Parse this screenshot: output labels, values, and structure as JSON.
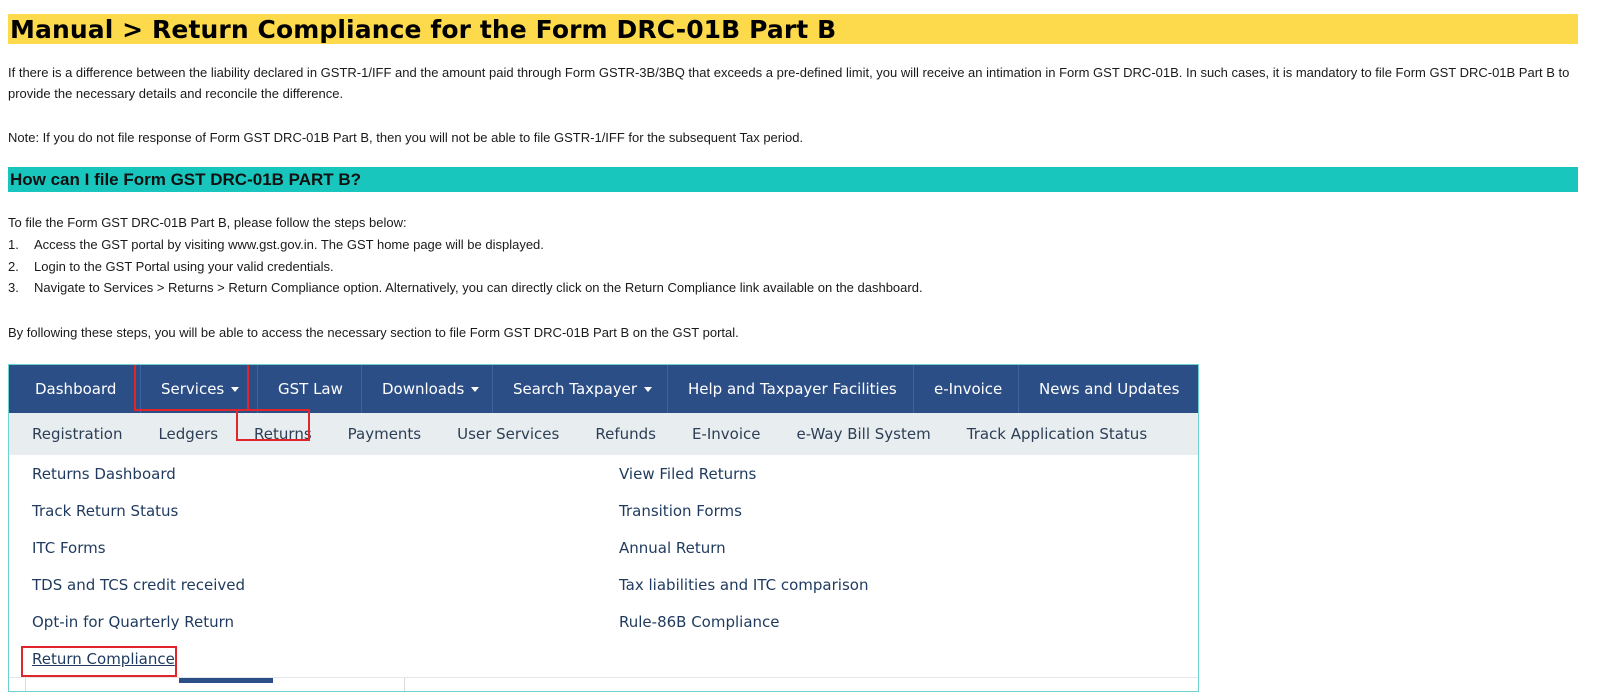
{
  "page": {
    "title": "Manual > Return Compliance for the Form DRC-01B Part B",
    "intro": "If there is a difference between the liability declared in GSTR-1/IFF and the amount paid through Form GSTR-3B/3BQ that exceeds a pre-defined limit, you will receive an intimation in Form GST DRC-01B. In such cases, it is mandatory to file Form GST DRC-01B Part B to provide the necessary details and reconcile the difference.",
    "note": "Note: If you do not file response of Form GST DRC-01B Part B, then you will not be able to file GSTR-1/IFF for the subsequent Tax period.",
    "section_heading": "How can I file Form GST DRC-01B PART B?",
    "steps_intro": "To file the Form GST DRC-01B Part B, please follow the steps below:",
    "steps": [
      {
        "num": "1.",
        "text": "Access the GST portal by visiting www.gst.gov.in. The GST home page will be displayed."
      },
      {
        "num": "2.",
        "text": "Login to the GST Portal using your valid credentials."
      },
      {
        "num": "3.",
        "text": "Navigate to Services > Returns > Return Compliance option. Alternatively, you can directly click on the Return Compliance link available on the dashboard."
      }
    ],
    "closing": "By following these steps, you will be able to access the necessary section to file Form GST DRC-01B Part B on the GST portal."
  },
  "portal": {
    "top_nav": [
      {
        "label": "Dashboard"
      },
      {
        "label": "Services"
      },
      {
        "label": "GST Law"
      },
      {
        "label": "Downloads"
      },
      {
        "label": "Search Taxpayer"
      },
      {
        "label": "Help and Taxpayer Facilities"
      },
      {
        "label": "e-Invoice"
      },
      {
        "label": "News and Updates"
      }
    ],
    "sub_nav": [
      {
        "label": "Registration"
      },
      {
        "label": "Ledgers"
      },
      {
        "label": "Returns"
      },
      {
        "label": "Payments"
      },
      {
        "label": "User Services"
      },
      {
        "label": "Refunds"
      },
      {
        "label": "E-Invoice"
      },
      {
        "label": "e-Way Bill System"
      },
      {
        "label": "Track Application Status"
      }
    ],
    "returns_menu": {
      "left": [
        "Returns Dashboard",
        "Track Return Status",
        "ITC Forms",
        "TDS and TCS credit received",
        "Opt-in for Quarterly Return",
        "Return Compliance"
      ],
      "right": [
        "View Filed Returns",
        "Transition Forms",
        "Annual Return",
        "Tax liabilities and ITC comparison",
        "Rule-86B Compliance"
      ]
    },
    "colors": {
      "nav_bg": "#2c4e86",
      "subnav_bg": "#e8edf0",
      "highlight": "#e0252b",
      "title_bg": "#fdd94c",
      "heading_bg": "#18c6bd"
    }
  }
}
